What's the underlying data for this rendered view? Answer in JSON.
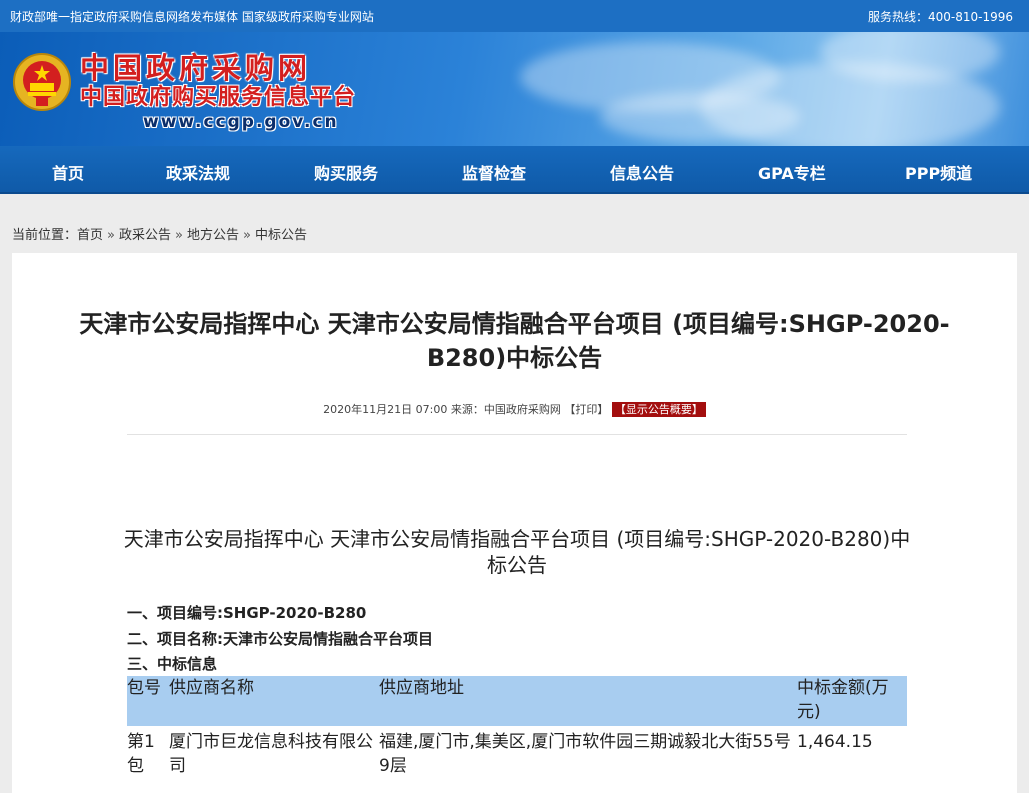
{
  "topbar": {
    "left_text": "财政部唯一指定政府采购信息网络发布媒体 国家级政府采购专业网站",
    "hotline": "服务热线：400-810-1996"
  },
  "header": {
    "logo_title": "中国政府采购网",
    "logo_subtitle": "中国政府购买服务信息平台",
    "logo_url": "www.ccgp.gov.cn"
  },
  "nav": {
    "items": [
      "首页",
      "政采法规",
      "购买服务",
      "监督检查",
      "信息公告",
      "GPA专栏",
      "PPP频道"
    ]
  },
  "breadcrumb": {
    "prefix": "当前位置：",
    "items": [
      "首页",
      "政采公告",
      "地方公告",
      "中标公告"
    ],
    "separator": "»"
  },
  "article": {
    "title": "天津市公安局指挥中心 天津市公安局情指融合平台项目 (项目编号:SHGP-2020-B280)中标公告",
    "meta_date": "2020年11月21日 07:00",
    "meta_source": "来源：中国政府采购网",
    "print_label": "【打印】",
    "summary_label": "【显示公告概要】",
    "doc_title": "天津市公安局指挥中心 天津市公安局情指融合平台项目 (项目编号:SHGP-2020-B280)中标公告",
    "line1": "一、项目编号:SHGP-2020-B280",
    "line2": "二、项目名称:天津市公安局情指融合平台项目",
    "line3": "三、中标信息",
    "table_headers": [
      "包号",
      "供应商名称",
      "供应商地址",
      "中标金额(万元)"
    ],
    "table_rows": [
      [
        "第1包",
        "厦门市巨龙信息科技有限公司",
        "福建,厦门市,集美区,厦门市软件园三期诚毅北大街55号9层",
        "1,464.15"
      ]
    ]
  }
}
